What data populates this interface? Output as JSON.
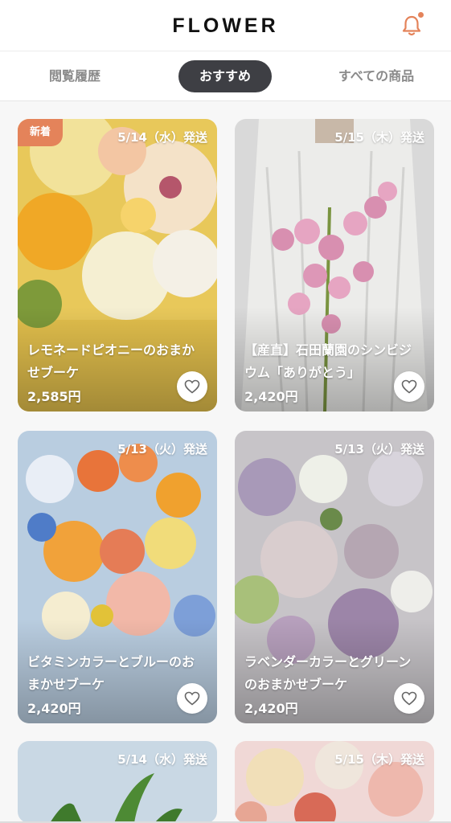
{
  "header": {
    "logo": "FLOWER",
    "notification_icon": "bell-icon",
    "accent_color": "#e4835a"
  },
  "tabs": [
    {
      "label": "閲覧履歴",
      "active": false
    },
    {
      "label": "おすすめ",
      "active": true
    },
    {
      "label": "すべての商品",
      "active": false
    }
  ],
  "products": [
    {
      "badge": "新着",
      "ship": "5/14（水）発送",
      "name": "レモネードピオニーのおまかせブーケ",
      "price": "2,585円"
    },
    {
      "badge": "",
      "ship": "5/15（木）発送",
      "name": "【産直】石田蘭園のシンビジウム「ありがとう」",
      "price": "2,420円"
    },
    {
      "badge": "",
      "ship": "5/13（火）発送",
      "name": "ビタミンカラーとブルーのおまかせブーケ",
      "price": "2,420円"
    },
    {
      "badge": "",
      "ship": "5/13（火）発送",
      "name": "ラベンダーカラーとグリーンのおまかせブーケ",
      "price": "2,420円"
    },
    {
      "badge": "",
      "ship": "5/14（水）発送",
      "name": "",
      "price": ""
    },
    {
      "badge": "",
      "ship": "5/15（木）発送",
      "name": "",
      "price": ""
    }
  ],
  "icons": {
    "favorite": "heart-icon"
  }
}
